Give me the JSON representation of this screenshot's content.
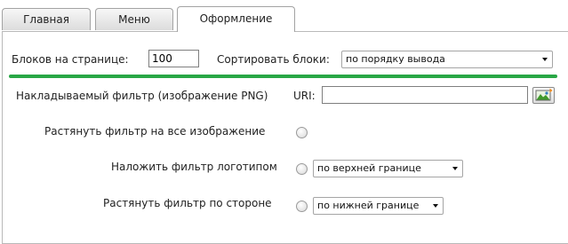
{
  "tabs": [
    {
      "label": "Главная"
    },
    {
      "label": "Меню"
    },
    {
      "label": "Оформление",
      "active": true
    }
  ],
  "blocks_per_page": {
    "label": "Блоков на странице:",
    "value": "100"
  },
  "sort_blocks": {
    "label": "Сортировать блоки:",
    "value": "по порядку вывода"
  },
  "filter": {
    "label": "Накладываемый фильтр (изображение PNG)",
    "uri_label": "URI:",
    "uri_value": ""
  },
  "options": {
    "stretch_all": {
      "label": "Растянуть фильтр на все изображение"
    },
    "logo": {
      "label": "Наложить фильтр логотипом",
      "select": "по верхней границе"
    },
    "stretch_side": {
      "label": "Растянуть фильтр по стороне",
      "select": "по нижней границе"
    }
  },
  "colors": {
    "accent_line": "#28a745"
  }
}
